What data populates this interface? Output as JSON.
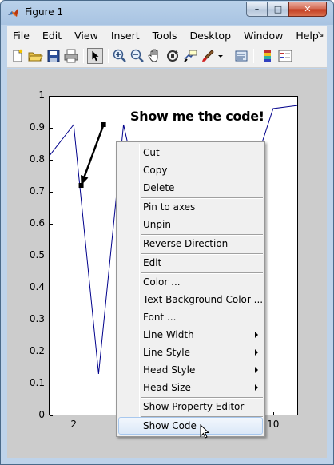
{
  "window": {
    "title": "Figure 1",
    "controls": {
      "minimize": "–",
      "maximize": "□",
      "close": "✕"
    }
  },
  "menubar": {
    "items": [
      "File",
      "Edit",
      "View",
      "Insert",
      "Tools",
      "Desktop",
      "Window",
      "Help"
    ],
    "close_glyph": "↘"
  },
  "toolbar": {
    "icons": [
      "new-figure-icon",
      "open-file-icon",
      "save-icon",
      "print-icon",
      "edit-plot-arrow-icon",
      "zoom-in-icon",
      "zoom-out-icon",
      "pan-hand-icon",
      "rotate-3d-icon",
      "data-cursor-icon",
      "brush-icon",
      "brush-dropdown-icon",
      "link-plot-icon",
      "colorbar-icon",
      "legend-icon"
    ],
    "pressed": "edit-plot-arrow-icon"
  },
  "plot": {
    "annotation_text": "Show me the code!",
    "line_color": "#00008b",
    "y_ticks": [
      "0",
      "0.1",
      "0.2",
      "0.3",
      "0.4",
      "0.5",
      "0.6",
      "0.7",
      "0.8",
      "0.9",
      "1"
    ],
    "x_ticks": [
      "2",
      "10"
    ]
  },
  "chart_data": {
    "type": "line",
    "x": [
      1,
      2,
      3,
      4,
      5,
      6,
      7,
      8,
      9,
      10,
      11
    ],
    "series": [
      {
        "values": [
          0.81,
          0.91,
          0.13,
          0.91,
          0.56,
          0.15,
          0.55,
          0.62,
          0.72,
          0.96,
          0.97
        ]
      }
    ],
    "xlim": [
      1,
      11
    ],
    "ylim": [
      0,
      1
    ],
    "x_ticks": [
      2,
      10
    ],
    "y_ticks": [
      0,
      0.1,
      0.2,
      0.3,
      0.4,
      0.5,
      0.6,
      0.7,
      0.8,
      0.9,
      1
    ],
    "annotation": {
      "text": "Show me the code!",
      "from": [
        3.2,
        0.91
      ],
      "to": [
        2.3,
        0.72
      ]
    },
    "grid": false
  },
  "context_menu": {
    "items": [
      {
        "label": "Cut"
      },
      {
        "label": "Copy"
      },
      {
        "label": "Delete"
      },
      {
        "label": "Pin to axes"
      },
      {
        "label": "Unpin"
      },
      {
        "label": "Reverse Direction"
      },
      {
        "label": "Edit"
      },
      {
        "label": "Color ..."
      },
      {
        "label": "Text Background Color ..."
      },
      {
        "label": "Font ..."
      },
      {
        "label": "Line Width",
        "submenu": true
      },
      {
        "label": "Line Style",
        "submenu": true
      },
      {
        "label": "Head Style",
        "submenu": true
      },
      {
        "label": "Head Size",
        "submenu": true
      },
      {
        "label": "Show Property Editor"
      },
      {
        "label": "Show Code",
        "highlighted": true
      }
    ]
  }
}
